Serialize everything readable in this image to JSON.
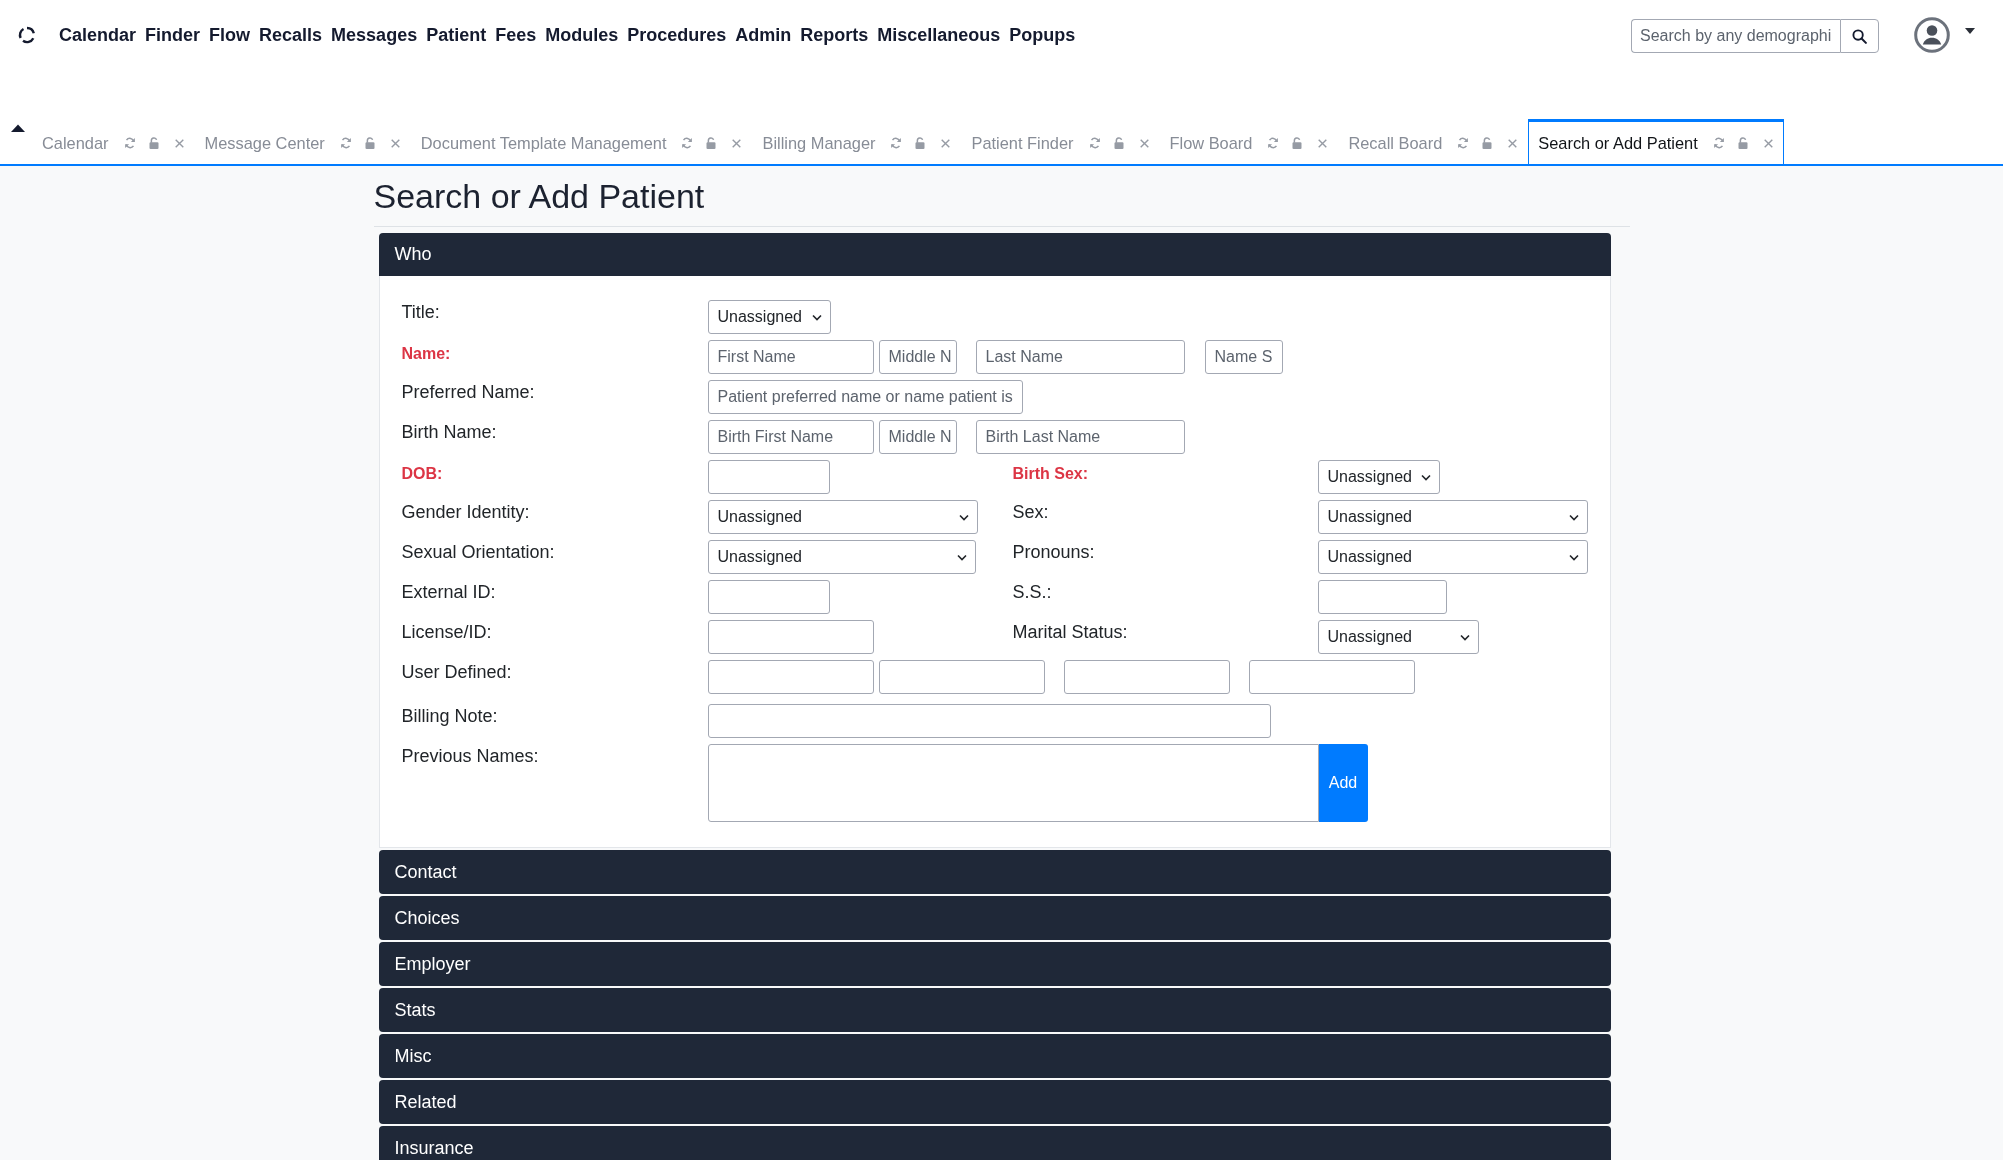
{
  "nav": {
    "items": [
      "Calendar",
      "Finder",
      "Flow",
      "Recalls",
      "Messages",
      "Patient",
      "Fees",
      "Modules",
      "Procedures",
      "Admin",
      "Reports",
      "Miscellaneous",
      "Popups"
    ]
  },
  "search": {
    "placeholder": "Search by any demographi"
  },
  "tabs": [
    {
      "label": "Calendar",
      "selected": false
    },
    {
      "label": "Message Center",
      "selected": false
    },
    {
      "label": "Document Template Management",
      "selected": false
    },
    {
      "label": "Billing Manager",
      "selected": false
    },
    {
      "label": "Patient Finder",
      "selected": false
    },
    {
      "label": "Flow Board",
      "selected": false
    },
    {
      "label": "Recall Board",
      "selected": false
    },
    {
      "label": "Search or Add Patient",
      "selected": true
    }
  ],
  "page": {
    "title": "Search or Add Patient"
  },
  "sections": [
    {
      "title": "Who",
      "expanded": true,
      "rows": [
        {
          "label": "Title:",
          "required": false,
          "controls": [
            {
              "kind": "select",
              "value": "Unassigned"
            }
          ]
        },
        {
          "label": "Name:",
          "required": true,
          "controls": [
            {
              "kind": "input",
              "placeholder": "First Name"
            },
            {
              "kind": "input",
              "placeholder": "Middle N"
            },
            {
              "kind": "input",
              "placeholder": "Last Name"
            },
            {
              "kind": "input",
              "placeholder": "Name S"
            }
          ]
        },
        {
          "label": "Preferred Name:",
          "required": false,
          "controls": [
            {
              "kind": "input",
              "placeholder": "Patient preferred name or name patient is"
            }
          ]
        },
        {
          "label": "Birth Name:",
          "required": false,
          "controls": [
            {
              "kind": "input",
              "placeholder": "Birth First Name"
            },
            {
              "kind": "input",
              "placeholder": "Middle N"
            },
            {
              "kind": "input",
              "placeholder": "Birth Last Name"
            }
          ]
        },
        {
          "label": "DOB:",
          "required": true,
          "controls": [
            {
              "kind": "input"
            }
          ],
          "pair": {
            "label": "Birth Sex:",
            "required": true,
            "controls": [
              {
                "kind": "select",
                "value": "Unassigned"
              }
            ]
          }
        },
        {
          "label": "Gender Identity:",
          "required": false,
          "controls": [
            {
              "kind": "select",
              "value": "Unassigned"
            }
          ],
          "pair": {
            "label": "Sex:",
            "required": false,
            "controls": [
              {
                "kind": "select",
                "value": "Unassigned"
              }
            ]
          }
        },
        {
          "label": "Sexual Orientation:",
          "required": false,
          "controls": [
            {
              "kind": "select",
              "value": "Unassigned"
            }
          ],
          "pair": {
            "label": "Pronouns:",
            "required": false,
            "controls": [
              {
                "kind": "select",
                "value": "Unassigned"
              }
            ]
          }
        },
        {
          "label": "External ID:",
          "required": false,
          "controls": [
            {
              "kind": "input"
            }
          ],
          "pair": {
            "label": "S.S.:",
            "required": false,
            "controls": [
              {
                "kind": "input"
              }
            ]
          }
        },
        {
          "label": "License/ID:",
          "required": false,
          "controls": [
            {
              "kind": "input"
            }
          ],
          "pair": {
            "label": "Marital Status:",
            "required": false,
            "controls": [
              {
                "kind": "select",
                "value": "Unassigned"
              }
            ]
          }
        },
        {
          "label": "User Defined:",
          "required": false,
          "controls": [
            {
              "kind": "input"
            },
            {
              "kind": "input"
            },
            {
              "kind": "input"
            },
            {
              "kind": "input"
            }
          ]
        },
        {
          "label": "Billing Note:",
          "required": false,
          "controls": [
            {
              "kind": "input"
            }
          ]
        },
        {
          "label": "Previous Names:",
          "required": false,
          "controls": [
            {
              "kind": "textarea"
            },
            {
              "kind": "button",
              "label": "Add"
            }
          ]
        }
      ]
    },
    {
      "title": "Contact",
      "expanded": false
    },
    {
      "title": "Choices",
      "expanded": false
    },
    {
      "title": "Employer",
      "expanded": false
    },
    {
      "title": "Stats",
      "expanded": false
    },
    {
      "title": "Misc",
      "expanded": false
    },
    {
      "title": "Related",
      "expanded": false
    },
    {
      "title": "Insurance",
      "expanded": false
    }
  ]
}
